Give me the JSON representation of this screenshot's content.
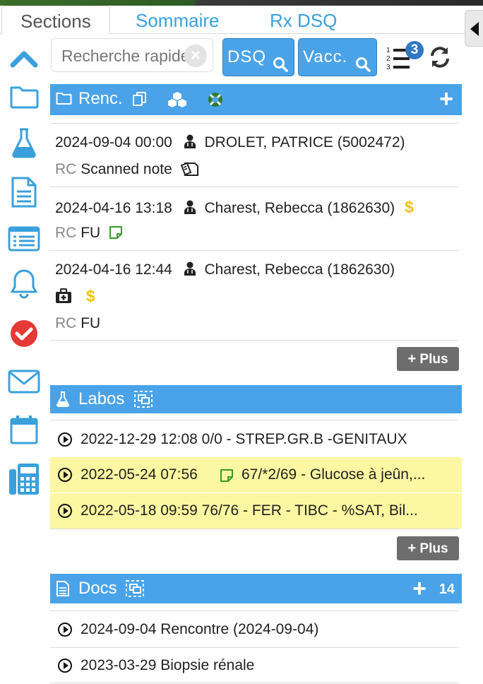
{
  "tabs": [
    {
      "label": "Sections",
      "active": true
    },
    {
      "label": "Sommaire",
      "active": false
    },
    {
      "label": "Rx DSQ",
      "active": false
    }
  ],
  "search": {
    "placeholder": "Recherche rapide",
    "value": ""
  },
  "buttons": {
    "dsq": "DSQ",
    "vacc": "Vacc.",
    "list_badge": "3"
  },
  "sidebar": {
    "icons": [
      "chevron-up-icon",
      "folder-icon",
      "flask-icon",
      "document-icon",
      "list-icon",
      "bell-icon",
      "check-circle-icon",
      "envelope-icon",
      "calendar-icon",
      "calculator-icon"
    ]
  },
  "encounters": {
    "title": "Renc.",
    "more_label": "Plus",
    "items": [
      {
        "datetime": "2024-09-04 00:00",
        "patient": "DROLET, PATRICE (5002472)",
        "prefix": "RC",
        "type": "Scanned note"
      },
      {
        "datetime": "2024-04-16 13:18",
        "patient": "Charest, Rebecca (1862630)",
        "prefix": "RC",
        "type": "FU"
      },
      {
        "datetime": "2024-04-16 12:44",
        "patient": "Charest, Rebecca (1862630)",
        "prefix": "RC",
        "type": "FU"
      }
    ]
  },
  "labs": {
    "title": "Labos",
    "more_label": "Plus",
    "items": [
      {
        "text": "2022-12-29 12:08 0/0 - STREP.GR.B -GENITAUX",
        "highlight": false
      },
      {
        "text": "2022-05-24 07:56",
        "text2": "67/*2/69 - Glucose à jeûn,...",
        "highlight": true
      },
      {
        "text": "2022-05-18 09:59 76/76 - FER - TIBC - %SAT, Bil...",
        "highlight": true
      }
    ]
  },
  "docs": {
    "title": "Docs",
    "count": "14",
    "items": [
      {
        "text": "2024-09-04 Rencontre (2024-09-04)"
      },
      {
        "text": "2023-03-29 Biopsie rénale"
      }
    ]
  },
  "colors": {
    "accent": "#4aa3e8",
    "highlight": "#fbf7a2",
    "dollar": "#f2c21b",
    "sidebar": "#3aa0dc",
    "check": "#e53935"
  }
}
